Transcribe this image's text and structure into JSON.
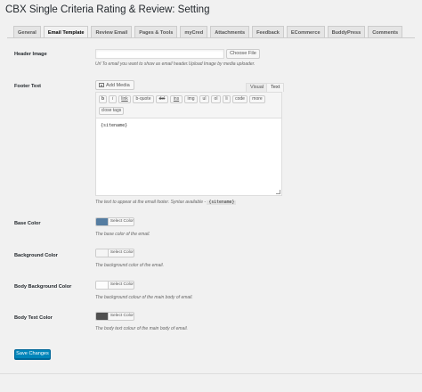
{
  "page": {
    "title": "CBX Single Criteria Rating & Review: Setting"
  },
  "tabs": [
    {
      "label": "General",
      "active": false
    },
    {
      "label": "Email Template",
      "active": true
    },
    {
      "label": "Review Email",
      "active": false
    },
    {
      "label": "Pages & Tools",
      "active": false
    },
    {
      "label": "myCred",
      "active": false
    },
    {
      "label": "Attachments",
      "active": false
    },
    {
      "label": "Feedback",
      "active": false
    },
    {
      "label": "ECommerce",
      "active": false
    },
    {
      "label": "BuddyPress",
      "active": false
    },
    {
      "label": "Comments",
      "active": false
    }
  ],
  "header_image": {
    "label": "Header Image",
    "value": "",
    "choose_label": "Choose File",
    "description": "Url To email you want to show as email header.Upload Image by media uploader."
  },
  "footer_text": {
    "label": "Footer Text",
    "add_media_label": "Add Media",
    "visual_tab": "Visual",
    "text_tab": "Text",
    "quicktags": [
      "b",
      "i",
      "link",
      "b-quote",
      "del",
      "ins",
      "img",
      "ul",
      "ol",
      "li",
      "code",
      "more",
      "close tags"
    ],
    "content": "{sitename}",
    "description": "The text to appear at the email footer. Syntax available -",
    "syntax_code": "{sitename}"
  },
  "colors": {
    "select_label": "Select Color",
    "base": {
      "label": "Base Color",
      "value": "#557da1",
      "description": "The base color of the email."
    },
    "background": {
      "label": "Background Color",
      "value": "#f5f5f5",
      "description": "The background color of the email."
    },
    "body_background": {
      "label": "Body Background Color",
      "value": "#fdfdfd",
      "description": "The background colour of the main body of email."
    },
    "body_text": {
      "label": "Body Text Color",
      "value": "#505050",
      "description": "The body text colour of the main body of email."
    }
  },
  "save_label": "Save Changes"
}
